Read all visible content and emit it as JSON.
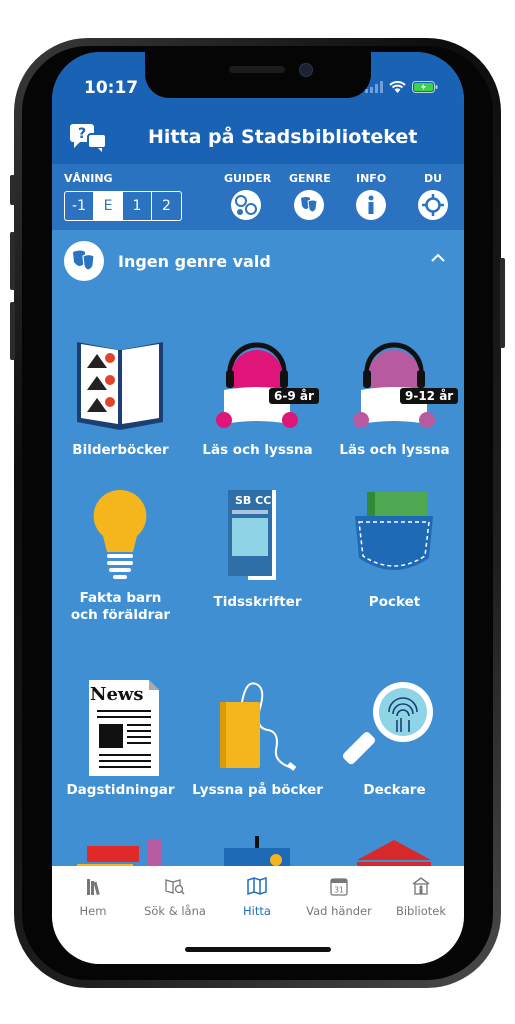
{
  "status": {
    "time": "10:17"
  },
  "header": {
    "title": "Hitta på Stadsbiblioteket",
    "chat_icon": "chat-question-icon"
  },
  "toolbar": {
    "floor_label": "VÅNING",
    "floors": [
      "-1",
      "E",
      "1",
      "2"
    ],
    "active_floor": "E",
    "guides_label": "GUIDER",
    "genre_label": "GENRE",
    "info_label": "INFO",
    "you_label": "DU"
  },
  "genre": {
    "label": "Ingen genre vald"
  },
  "tiles": [
    {
      "caption": "Bilderböcker",
      "icon": "picture-book-icon"
    },
    {
      "caption": "Läs och lyssna",
      "badge": "6-9 år",
      "icon": "read-listen-icon"
    },
    {
      "caption": "Läs och lyssna",
      "badge": "9-12 år",
      "icon": "read-listen-icon"
    },
    {
      "caption_line1": "Fakta barn",
      "caption_line2": "och föräldrar",
      "icon": "lightbulb-icon"
    },
    {
      "caption": "Tidsskrifter",
      "badge": "SB CC",
      "icon": "magazine-icon"
    },
    {
      "caption": "Pocket",
      "icon": "pocket-icon"
    },
    {
      "caption": "Dagstidningar",
      "badge": "News",
      "icon": "newspaper-icon"
    },
    {
      "caption": "Lyssna på böcker",
      "icon": "audiobook-icon"
    },
    {
      "caption": "Deckare",
      "icon": "magnifier-fingerprint-icon"
    },
    {
      "icon": "books-stack-icon"
    },
    {
      "icon": "easel-painting-icon"
    },
    {
      "icon": "museum-building-icon"
    }
  ],
  "tabs": [
    {
      "label": "Hem",
      "icon": "home-books-icon"
    },
    {
      "label": "Sök & låna",
      "icon": "search-book-icon"
    },
    {
      "label": "Hitta",
      "icon": "map-icon",
      "active": true
    },
    {
      "label": "Vad händer",
      "icon": "calendar-icon",
      "day": "31"
    },
    {
      "label": "Bibliotek",
      "icon": "library-icon"
    }
  ],
  "colors": {
    "brand_dark": "#1a62b4",
    "brand": "#2b73c1",
    "background": "#3f8fd2",
    "active_tab": "#1f6ec0"
  }
}
